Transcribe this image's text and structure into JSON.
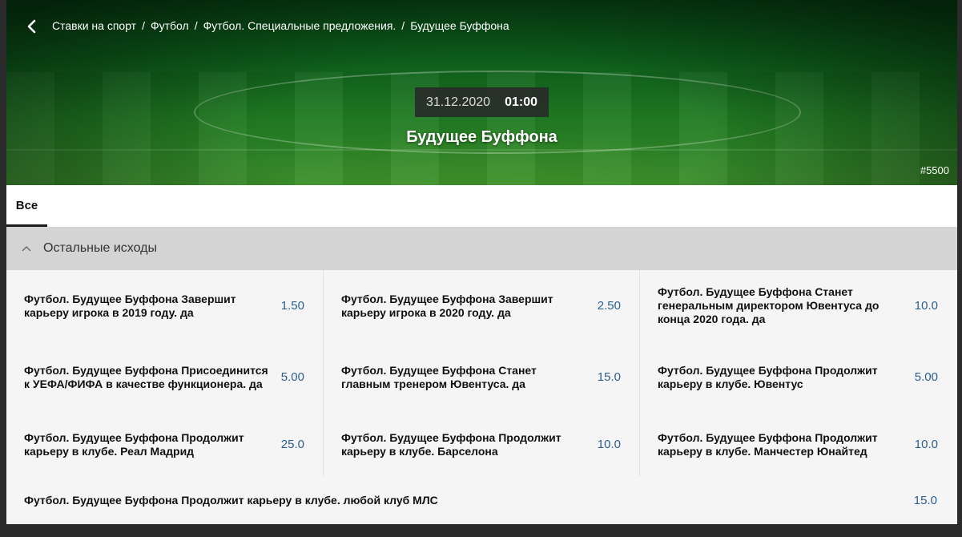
{
  "breadcrumb": [
    "Ставки на спорт",
    "Футбол",
    "Футбол. Специальные предложения.",
    "Будущее Буффона"
  ],
  "event": {
    "date": "31.12.2020",
    "time": "01:00",
    "title": "Будущее Буффона",
    "id": "#5500"
  },
  "tabs": [
    "Все"
  ],
  "section": {
    "title": "Остальные исходы"
  },
  "outcomes": [
    {
      "name": "Футбол. Будущее Буффона Завершит карьеру игрока в 2019 году. да",
      "odd": "1.50"
    },
    {
      "name": "Футбол. Будущее Буффона Завершит карьеру игрока в 2020 году. да",
      "odd": "2.50"
    },
    {
      "name": "Футбол. Будущее Буффона Станет генеральным директором Ювентуса до конца 2020 года. да",
      "odd": "10.0"
    },
    {
      "name": "Футбол. Будущее Буффона Присоединится к УЕФА/ФИФА в качестве функционера. да",
      "odd": "5.00"
    },
    {
      "name": "Футбол. Будущее Буффона Станет главным тренером Ювентуса. да",
      "odd": "15.0"
    },
    {
      "name": "Футбол. Будущее Буффона Продолжит карьеру в клубе. Ювентус",
      "odd": "5.00"
    },
    {
      "name": "Футбол. Будущее Буффона Продолжит карьеру в клубе. Реал Мадрид",
      "odd": "25.0"
    },
    {
      "name": "Футбол. Будущее Буффона Продолжит карьеру в клубе. Барселона",
      "odd": "10.0"
    },
    {
      "name": "Футбол. Будущее Буффона Продолжит карьеру в клубе. Манчестер Юнайтед",
      "odd": "10.0"
    },
    {
      "name": "Футбол. Будущее Буффона Продолжит карьеру в клубе. любой клуб МЛС",
      "odd": "15.0"
    }
  ],
  "colors": {
    "odd": "#2b5f8f",
    "section_bg": "#d4d4d4",
    "hero_green": "#1f7a22"
  },
  "icons": {
    "back": "chevron-left-icon",
    "collapse": "chevron-up-icon"
  }
}
